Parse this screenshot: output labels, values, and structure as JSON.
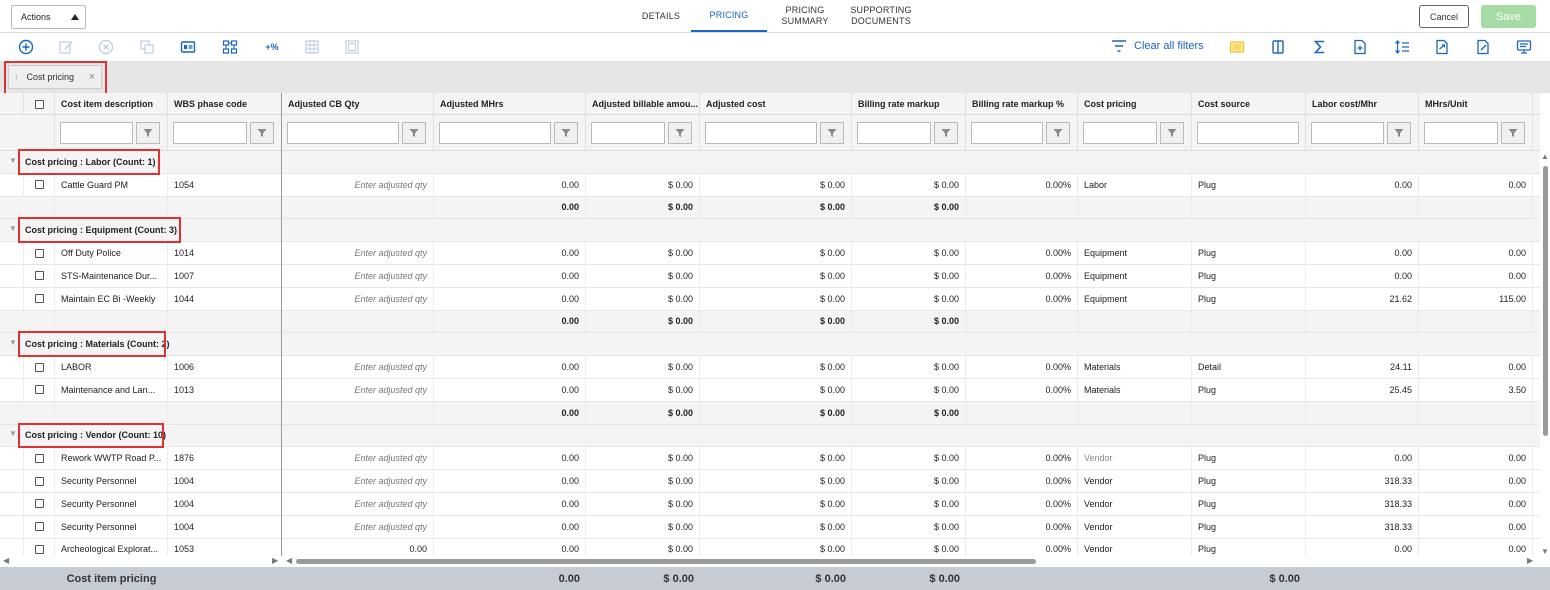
{
  "actions": {
    "label": "Actions"
  },
  "tabs": [
    {
      "label": "DETAILS",
      "active": false
    },
    {
      "label": "PRICING",
      "active": true
    },
    {
      "label": "PRICING\nSUMMARY",
      "active": false
    },
    {
      "label": "SUPPORTING\nDOCUMENTS",
      "active": false
    }
  ],
  "buttons": {
    "cancel": "Cancel",
    "save": "Save"
  },
  "toolbar": {
    "clear_filters": "Clear all filters",
    "percent_icon": "+%",
    "colors": {
      "accent": "#1a64c4",
      "disabled": "#b9cde8",
      "highlight": "#f2c230"
    }
  },
  "group_chip": {
    "label": "Cost pricing"
  },
  "columns": [
    "Cost item description",
    "WBS phase code",
    "Adjusted CB Qty",
    "Adjusted MHrs",
    "Adjusted billable amou...",
    "Adjusted cost",
    "Billing rate markup",
    "Billing rate markup %",
    "Cost pricing",
    "Cost source",
    "Labor cost/Mhr",
    "MHrs/Unit"
  ],
  "qty_placeholder": "Enter adjusted qty",
  "groups": [
    {
      "label": "Cost pricing : Labor (Count: 1)",
      "rows": [
        [
          "Cattle Guard PM",
          "1054",
          "",
          "0.00",
          "$ 0.00",
          "$ 0.00",
          "$ 0.00",
          "0.00%",
          "Labor",
          "Plug",
          "0.00",
          "0.00"
        ]
      ],
      "subtotal": [
        "0.00",
        "$ 0.00",
        "$ 0.00",
        "$ 0.00"
      ]
    },
    {
      "label": "Cost pricing : Equipment (Count: 3)",
      "rows": [
        [
          "Off Duty Police",
          "1014",
          "",
          "0.00",
          "$ 0.00",
          "$ 0.00",
          "$ 0.00",
          "0.00%",
          "Equipment",
          "Plug",
          "0.00",
          "0.00"
        ],
        [
          "STS-Maintenance Dur...",
          "1007",
          "",
          "0.00",
          "$ 0.00",
          "$ 0.00",
          "$ 0.00",
          "0.00%",
          "Equipment",
          "Plug",
          "0.00",
          "0.00"
        ],
        [
          "Maintain EC Bi -Weekly",
          "1044",
          "",
          "0.00",
          "$ 0.00",
          "$ 0.00",
          "$ 0.00",
          "0.00%",
          "Equipment",
          "Plug",
          "21.62",
          "115.00"
        ]
      ],
      "subtotal": [
        "0.00",
        "$ 0.00",
        "$ 0.00",
        "$ 0.00"
      ]
    },
    {
      "label": "Cost pricing : Materials (Count: 2)",
      "rows": [
        [
          "LABOR",
          "1006",
          "",
          "0.00",
          "$ 0.00",
          "$ 0.00",
          "$ 0.00",
          "0.00%",
          "Materials",
          "Detail",
          "24.11",
          "0.00"
        ],
        [
          "Maintenance and Lan...",
          "1013",
          "",
          "0.00",
          "$ 0.00",
          "$ 0.00",
          "$ 0.00",
          "0.00%",
          "Materials",
          "Plug",
          "25.45",
          "3.50"
        ]
      ],
      "subtotal": [
        "0.00",
        "$ 0.00",
        "$ 0.00",
        "$ 0.00"
      ]
    },
    {
      "label": "Cost pricing : Vendor (Count: 10)",
      "rows": [
        [
          "Rework WWTP Road P...",
          "1876",
          "",
          "0.00",
          "$ 0.00",
          "$ 0.00",
          "$ 0.00",
          "0.00%",
          "Vendor",
          "Plug",
          "0.00",
          "0.00"
        ],
        [
          "Security Personnel",
          "1004",
          "",
          "0.00",
          "$ 0.00",
          "$ 0.00",
          "$ 0.00",
          "0.00%",
          "Vendor",
          "Plug",
          "318.33",
          "0.00"
        ],
        [
          "Security Personnel",
          "1004",
          "",
          "0.00",
          "$ 0.00",
          "$ 0.00",
          "$ 0.00",
          "0.00%",
          "Vendor",
          "Plug",
          "318.33",
          "0.00"
        ],
        [
          "Security Personnel",
          "1004",
          "",
          "0.00",
          "$ 0.00",
          "$ 0.00",
          "$ 0.00",
          "0.00%",
          "Vendor",
          "Plug",
          "318.33",
          "0.00"
        ],
        [
          "Archeological Explorat...",
          "1053",
          "0.00",
          "0.00",
          "$ 0.00",
          "$ 0.00",
          "$ 0.00",
          "0.00%",
          "Vendor",
          "Plug",
          "0.00",
          "0.00"
        ]
      ],
      "subtotal": null
    }
  ],
  "footer": {
    "label": "Cost item pricing",
    "values": [
      "0.00",
      "$ 0.00",
      "$ 0.00",
      "$ 0.00",
      "$ 0.00"
    ]
  }
}
